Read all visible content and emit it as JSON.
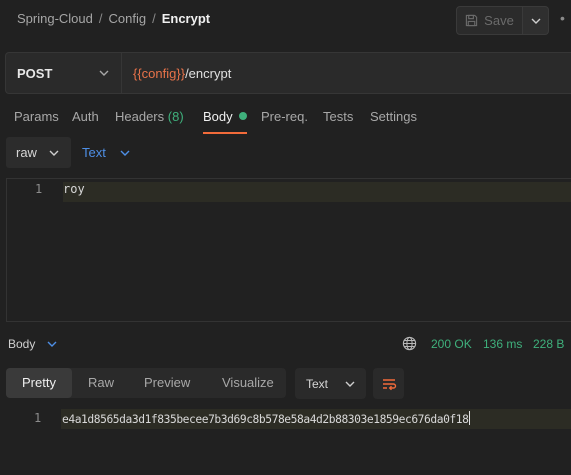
{
  "breadcrumb": {
    "items": [
      "Spring-Cloud",
      "Config"
    ],
    "current": "Encrypt",
    "separator": "/"
  },
  "toolbar": {
    "save_label": "Save",
    "save_icon": "floppy-disk-icon",
    "more_icon": "ellipsis-icon"
  },
  "request": {
    "method": "POST",
    "url_variable": "{{config}}",
    "url_path": "/encrypt"
  },
  "tabs": [
    {
      "label": "Params"
    },
    {
      "label": "Auth"
    },
    {
      "label": "Headers",
      "count": "(8)"
    },
    {
      "label": "Body",
      "active": true,
      "indicator": "dot"
    },
    {
      "label": "Pre-req."
    },
    {
      "label": "Tests"
    },
    {
      "label": "Settings"
    }
  ],
  "body_options": {
    "mode": "raw",
    "format": "Text"
  },
  "editor": {
    "line_number": "1",
    "content": "roy"
  },
  "response": {
    "section_label": "Body",
    "status": "200 OK",
    "time": "136 ms",
    "size": "228 B",
    "view_tabs": [
      "Pretty",
      "Raw",
      "Preview",
      "Visualize"
    ],
    "active_view": "Pretty",
    "format": "Text",
    "line_number": "1",
    "content": "e4a1d8565da3d1f835becee7b3d69c8b578e58a4d2b88303e1859ec676da0f18"
  },
  "colors": {
    "accent": "#f26b3a",
    "success": "#3fb07c",
    "link_blue": "#4e8fe6",
    "variable": "#e8734a"
  }
}
